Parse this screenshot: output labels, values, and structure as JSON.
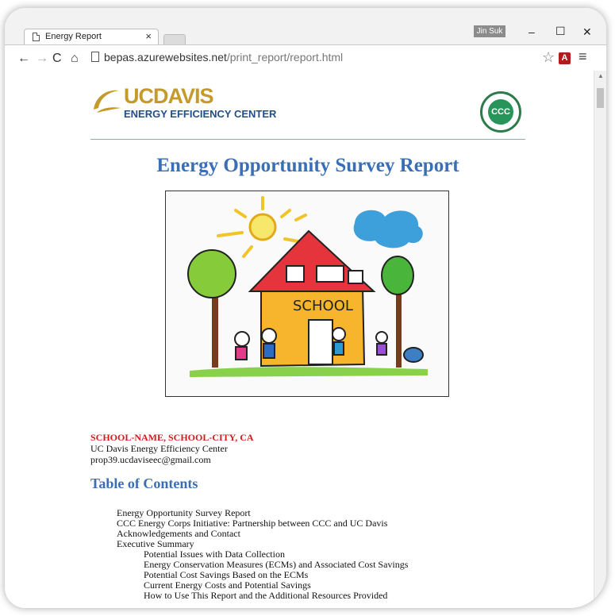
{
  "browser": {
    "tab_title": "Energy Report",
    "tab_close": "×",
    "user_badge": "Jin Suk",
    "url_host": "bepas.azurewebsites.net",
    "url_path": "/print_report/report.html",
    "controls": {
      "minimize": "–",
      "maximize": "☐",
      "close": "✕"
    },
    "icons": {
      "back": "←",
      "forward": "→",
      "reload": "C",
      "home": "⌂",
      "star": "☆",
      "pdf": "A",
      "menu": "≡",
      "scroll_up": "▲"
    }
  },
  "page": {
    "logo_left": {
      "uc": "UC",
      "davis": "DAVIS",
      "subtitle": "ENERGY EFFICIENCY CENTER"
    },
    "logo_right_text": "CCC",
    "title": "Energy Opportunity Survey Report",
    "address": {
      "school": "SCHOOL-NAME, SCHOOL-CITY, CA",
      "org": "UC Davis Energy Efficiency Center",
      "email": "prop39.ucdaviseec@gmail.com"
    },
    "toc_title": "Table of Contents",
    "toc": [
      {
        "text": "Energy Opportunity Survey Report",
        "level": 0
      },
      {
        "text": "CCC Energy Corps Initiative: Partnership between CCC and UC Davis",
        "level": 0
      },
      {
        "text": "Acknowledgements and Contact",
        "level": 0
      },
      {
        "text": "Executive Summary",
        "level": 0
      },
      {
        "text": "Potential Issues with Data Collection",
        "level": 1
      },
      {
        "text": "Energy Conservation Measures (ECMs) and Associated Cost Savings",
        "level": 1
      },
      {
        "text": "Potential Cost Savings Based on the ECMs",
        "level": 1
      },
      {
        "text": "Current Energy Costs and Potential Savings",
        "level": 1
      },
      {
        "text": "How to Use This Report and the Additional Resources Provided",
        "level": 1
      }
    ],
    "drawing_label": "SCHOOL"
  },
  "colors": {
    "title_blue": "#3a6fb5",
    "school_red": "#d21b1b",
    "uc_gold": "#c49a2a",
    "eec_blue": "#214f87"
  }
}
